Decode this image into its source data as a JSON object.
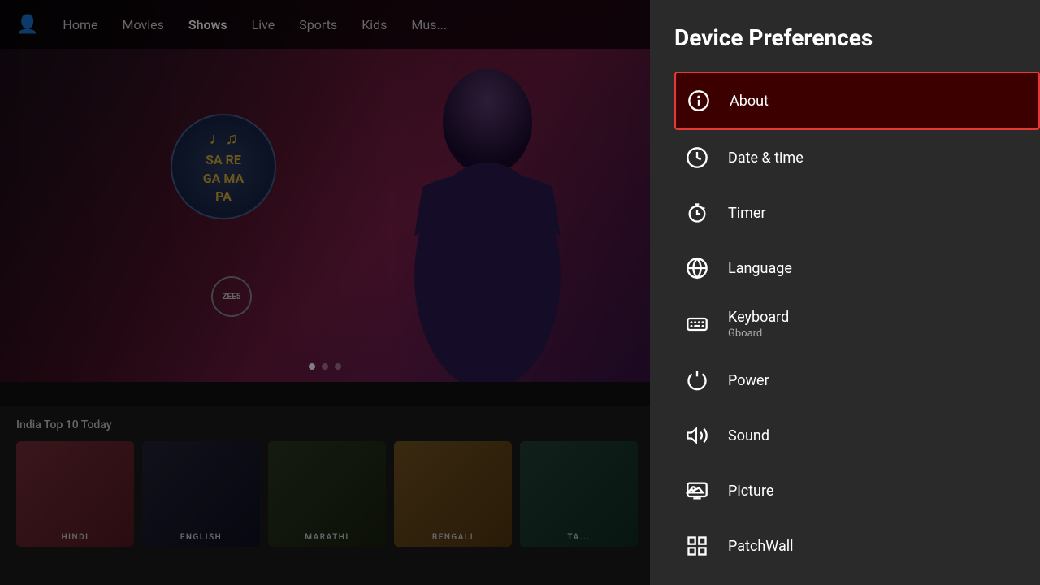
{
  "app": {
    "title": "ZEE5"
  },
  "nav": {
    "profile_icon": "👤",
    "items": [
      {
        "id": "home",
        "label": "Home",
        "active": false
      },
      {
        "id": "movies",
        "label": "Movies",
        "active": false
      },
      {
        "id": "shows",
        "label": "Shows",
        "active": true
      },
      {
        "id": "live",
        "label": "Live",
        "active": false
      },
      {
        "id": "sports",
        "label": "Sports",
        "active": false
      },
      {
        "id": "kids",
        "label": "Kids",
        "active": false
      },
      {
        "id": "music",
        "label": "Mus...",
        "active": false
      }
    ]
  },
  "hero": {
    "show_name_line1": "SA  RE",
    "show_name_line2": "GA  MA",
    "show_name_line3": "PA",
    "music_note": "♩♫",
    "zee5_label": "ZEE5"
  },
  "thumbnails": {
    "section_title": "India Top 10 Today",
    "items": [
      {
        "id": "hindi",
        "label": "HINDI"
      },
      {
        "id": "english",
        "label": "ENGLISH"
      },
      {
        "id": "marathi",
        "label": "MARATHI"
      },
      {
        "id": "bengali",
        "label": "BENGALI"
      },
      {
        "id": "ta",
        "label": "TA..."
      }
    ]
  },
  "sidebar": {
    "title": "Device Preferences",
    "menu_items": [
      {
        "id": "about",
        "label": "About",
        "sublabel": null,
        "selected": true,
        "icon_type": "info"
      },
      {
        "id": "date-time",
        "label": "Date & time",
        "sublabel": null,
        "selected": false,
        "icon_type": "clock"
      },
      {
        "id": "timer",
        "label": "Timer",
        "sublabel": null,
        "selected": false,
        "icon_type": "timer"
      },
      {
        "id": "language",
        "label": "Language",
        "sublabel": null,
        "selected": false,
        "icon_type": "globe"
      },
      {
        "id": "keyboard",
        "label": "Keyboard",
        "sublabel": "Gboard",
        "selected": false,
        "icon_type": "keyboard"
      },
      {
        "id": "power",
        "label": "Power",
        "sublabel": null,
        "selected": false,
        "icon_type": "power"
      },
      {
        "id": "sound",
        "label": "Sound",
        "sublabel": null,
        "selected": false,
        "icon_type": "sound"
      },
      {
        "id": "picture",
        "label": "Picture",
        "sublabel": null,
        "selected": false,
        "icon_type": "picture"
      },
      {
        "id": "patchwall",
        "label": "PatchWall",
        "sublabel": null,
        "selected": false,
        "icon_type": "grid"
      }
    ]
  },
  "colors": {
    "selected_border": "#e53935",
    "selected_bg": "#3d0000",
    "sidebar_bg": "#2a2a2a",
    "nav_active": "#ffffff"
  }
}
